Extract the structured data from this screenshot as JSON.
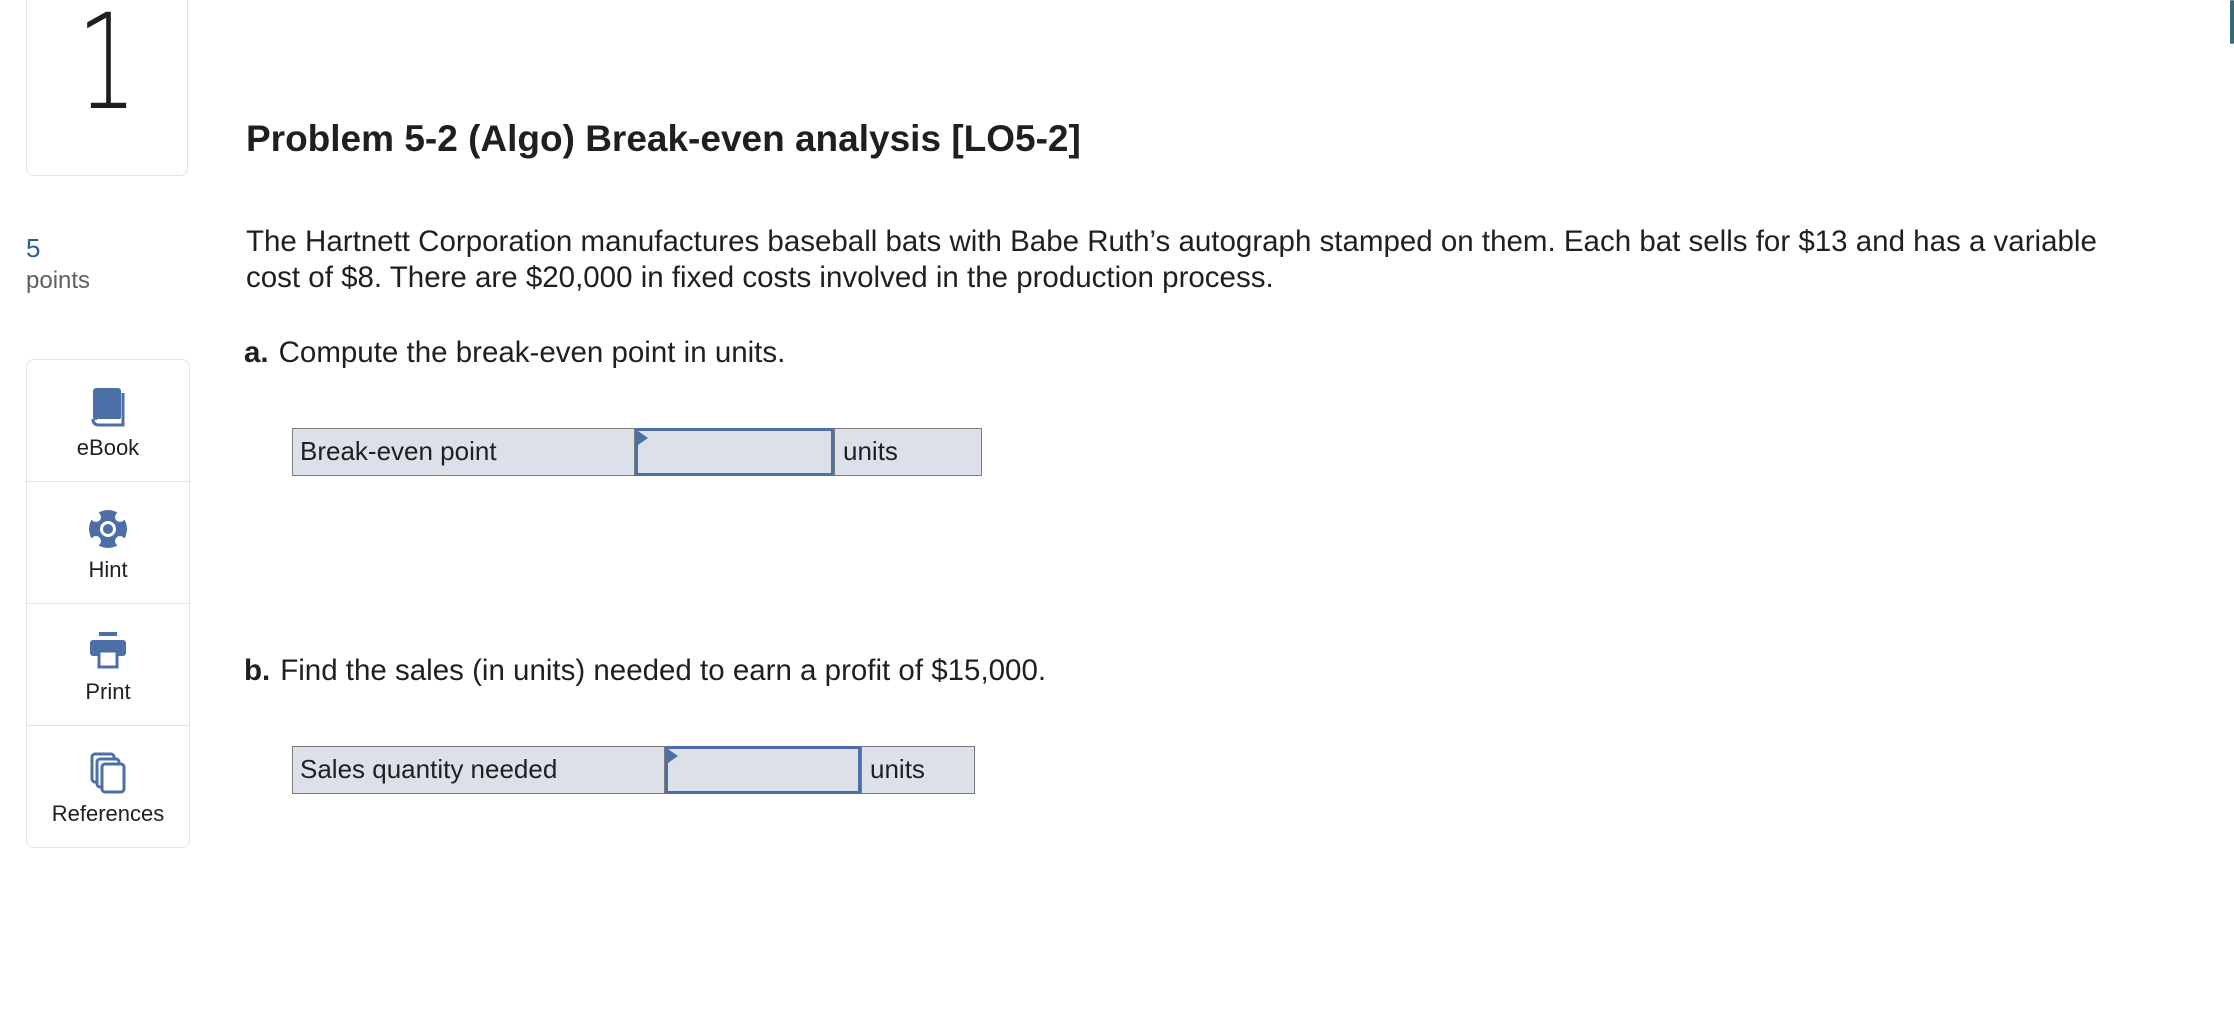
{
  "question": {
    "number": "1",
    "points_value": "5",
    "points_label": "points"
  },
  "tools": [
    {
      "label": "eBook",
      "icon": "book-icon"
    },
    {
      "label": "Hint",
      "icon": "lifebuoy-icon"
    },
    {
      "label": "Print",
      "icon": "printer-icon"
    },
    {
      "label": "References",
      "icon": "documents-icon"
    }
  ],
  "problem": {
    "title": "Problem 5-2 (Algo) Break-even analysis [LO5-2]",
    "prompt": "The Hartnett Corporation manufactures baseball bats with Babe Ruth’s autograph stamped on them. Each bat sells for $13 and has a variable cost of $8. There are $20,000 in fixed costs involved in the production process."
  },
  "parts": [
    {
      "letter": "a.",
      "text": "Compute the break-even point in units.",
      "row_label": "Break-even point",
      "value": "",
      "unit": "units"
    },
    {
      "letter": "b.",
      "text": "Find the sales (in units) needed to earn a profit of $15,000.",
      "row_label": "Sales quantity needed",
      "value": "",
      "unit": "units"
    }
  ],
  "colors": {
    "accent": "#4d6fa8",
    "points": "#2c5c9a",
    "answer_bg": "#dce0e9"
  }
}
